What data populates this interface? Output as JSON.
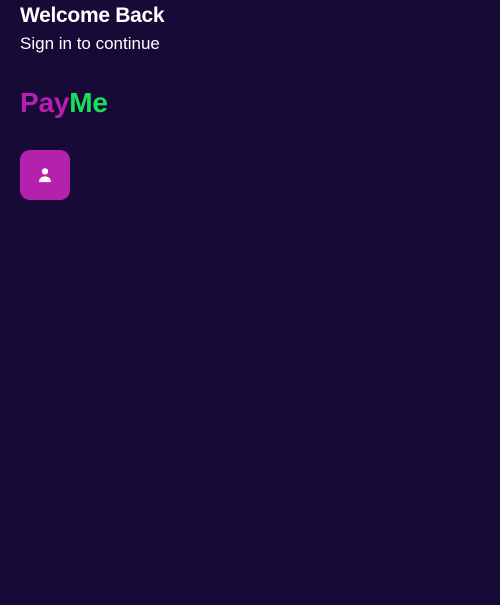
{
  "header": {
    "title": "Welcome Back",
    "subtitle": "Sign in to continue"
  },
  "brand": {
    "part1": "Pay",
    "part2": "Me",
    "colors": {
      "part1": "#b51fb2",
      "part2": "#19e05b"
    }
  },
  "profile": {
    "icon": "person-icon",
    "background": "#b421ad"
  },
  "theme": {
    "background": "#170a36",
    "text": "#ffffff"
  }
}
